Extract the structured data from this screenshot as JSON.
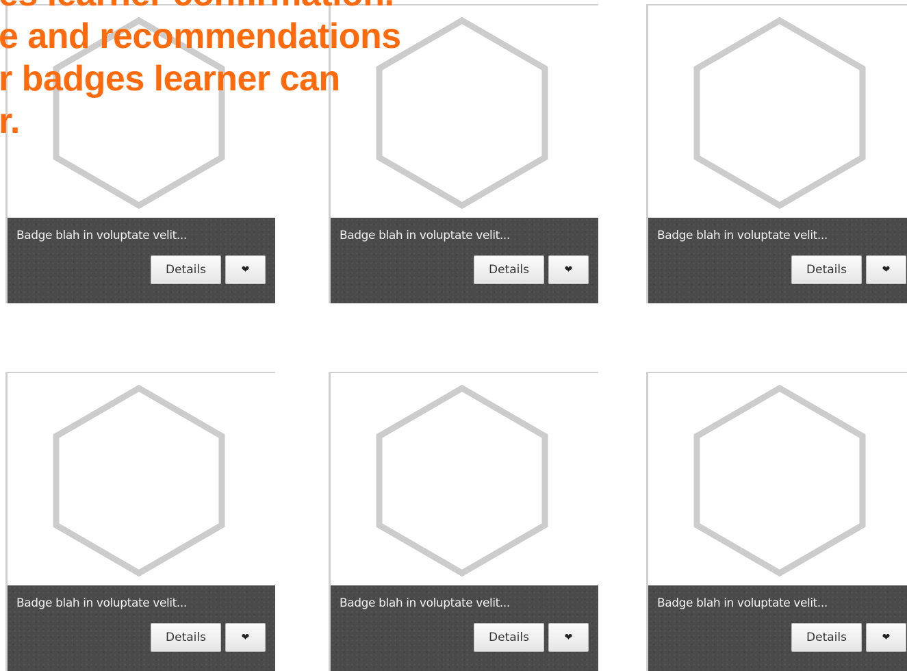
{
  "overlay_text": {
    "lines": [
      "es learner confirmation.",
      "e and recommendations",
      "r badges learner can",
      "r."
    ]
  },
  "badge_grid": {
    "cards": [
      {
        "title": "Badge blah in voluptate velit...",
        "details_label": "Details",
        "favorite_icon": "heart-icon"
      },
      {
        "title": "Badge blah in voluptate velit...",
        "details_label": "Details",
        "favorite_icon": "heart-icon"
      },
      {
        "title": "Badge blah in voluptate velit...",
        "details_label": "Details",
        "favorite_icon": "heart-icon"
      },
      {
        "title": "Badge blah in voluptate velit...",
        "details_label": "Details",
        "favorite_icon": "heart-icon"
      },
      {
        "title": "Badge blah in voluptate velit...",
        "details_label": "Details",
        "favorite_icon": "heart-icon"
      },
      {
        "title": "Badge blah in voluptate velit...",
        "details_label": "Details",
        "favorite_icon": "heart-icon"
      }
    ]
  },
  "colors": {
    "overlay_text": "#ff6a0d",
    "card_bar": "#4a4a4a",
    "hexagon_outline": "#cccccc"
  }
}
